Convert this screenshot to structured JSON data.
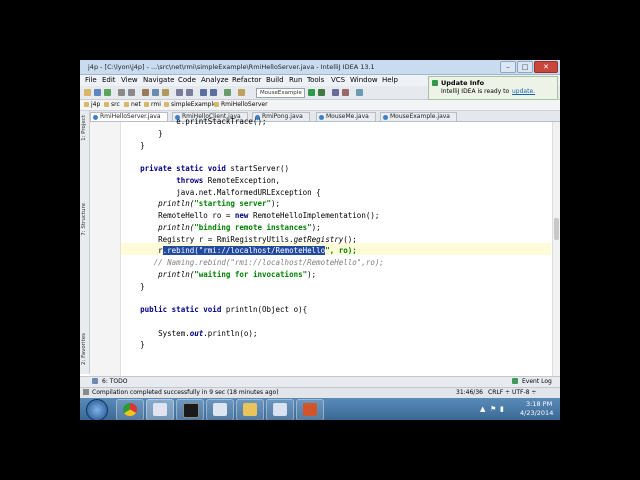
{
  "window": {
    "title": "j4p - [C:\\lyon\\j4p] - ...\\src\\net\\rmi\\simpleExample\\RmiHelloServer.java - IntelliJ IDEA 13.1"
  },
  "window_controls": {
    "minimize": "–",
    "maximize": "□",
    "close": "✕"
  },
  "menu": [
    "File",
    "Edit",
    "View",
    "Navigate",
    "Code",
    "Analyze",
    "Refactor",
    "Build",
    "Run",
    "Tools",
    "VCS",
    "Window",
    "Help"
  ],
  "toolbar": {
    "run_config": "MouseExample"
  },
  "breadcrumbs": [
    "j4p",
    "src",
    "net",
    "rmi",
    "simpleExample",
    "RmiHelloServer"
  ],
  "tabs": [
    "RmiHelloServer.java",
    "RmiHelloClient.java",
    "RmiPong.java",
    "MouseMe.java",
    "MouseExample.java"
  ],
  "side_tabs": {
    "project": "1: Project",
    "structure": "7: Structure",
    "favorites": "2: Favorites"
  },
  "notification": {
    "title": "Update Info",
    "text": "IntelliJ IDEA is ready to",
    "link": "update."
  },
  "code": {
    "l0": "e.printStackTrace();",
    "l1": "}",
    "l2": "}",
    "l3a": "private static void",
    "l3b": " startServer()",
    "l4a": "throws",
    "l4b": " RemoteException,",
    "l5": "java.net.MalformedURLException {",
    "l6a": "println(",
    "l6b": "\"starting server\"",
    "l6c": ");",
    "l7a": "RemoteHello ro = ",
    "l7b": "new",
    "l7c": " RemoteHelloImplementation();",
    "l8a": "println(",
    "l8b": "\"binding remote instances\"",
    "l8c": ");",
    "l9a": "Registry r = RmiRegistryUtils.",
    "l9b": "getRegistry",
    "l9c": "();",
    "l10a": "r",
    "l10b": ".rebind(\"rmi://localhost/RemoteHello",
    "l10c": "\", ro);",
    "l11": "// Naming.rebind(\"rmi://localhost/RemoteHello\",ro);",
    "l12a": "println(",
    "l12b": "\"waiting for invocations\"",
    "l12c": ");",
    "l13": "}",
    "l14a": "public static void",
    "l14b": " println(Object o){",
    "l15a": "System.",
    "l15b": "out",
    "l15c": ".println(o);",
    "l16": "}"
  },
  "bottom_tool": {
    "todo": "6: TODO",
    "event_log": "Event Log"
  },
  "status": {
    "message": "Compilation completed successfully in 9 sec (18 minutes ago)",
    "position": "31:46/36",
    "line_sep": "CRLF ÷",
    "encoding": "UTF-8 ÷"
  },
  "taskbar": {
    "time": "3:18 PM",
    "date": "4/23/2014"
  },
  "colors": {
    "keyword": "#000080",
    "string": "#008000",
    "comment": "#808080",
    "selection": "#224aa0"
  }
}
